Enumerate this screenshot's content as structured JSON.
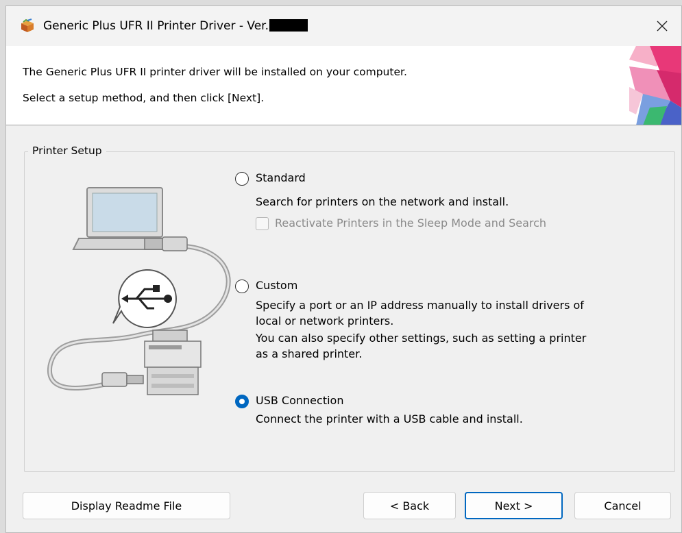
{
  "window": {
    "title": "Generic Plus UFR II Printer Driver - Ver."
  },
  "header": {
    "line1": "The Generic Plus UFR II printer driver will be installed on your computer.",
    "line2": "Select a setup method, and then click [Next]."
  },
  "printer_setup": {
    "label": "Printer Setup",
    "options": [
      {
        "label": "Standard",
        "checked": false,
        "description": [
          "Search for printers on the network and install."
        ]
      },
      {
        "label": "Custom",
        "checked": false,
        "description": [
          "Specify a port or an IP address manually to install drivers of",
          "local or network printers.",
          "You can also specify other settings, such as setting a printer",
          "as a shared printer."
        ]
      },
      {
        "label": "USB Connection",
        "checked": true,
        "description": [
          "Connect the printer with a USB cable and install."
        ]
      }
    ],
    "sleep_checkbox": {
      "label": "Reactivate Printers in the Sleep Mode and Search",
      "checked": false,
      "disabled": true
    }
  },
  "buttons": {
    "readme": "Display Readme File",
    "back": "< Back",
    "next": "Next >",
    "cancel": "Cancel"
  },
  "colors": {
    "accent": "#0067c0",
    "disabled_text": "#8a8a8a"
  },
  "icons": {
    "app": "installer-box-icon",
    "close": "close-icon",
    "usb": "usb-icon"
  }
}
